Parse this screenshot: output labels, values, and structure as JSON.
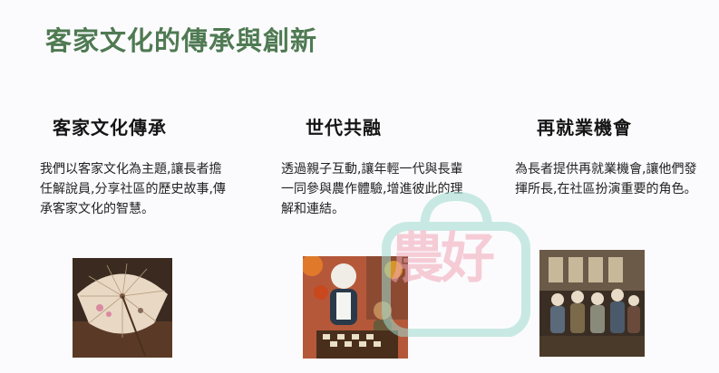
{
  "page": {
    "title": "客家文化的傳承與創新"
  },
  "columns": [
    {
      "title": "客家文化傳承",
      "text": "我們以客家文化為主題,讓長者擔任解說員,分享社區的歷史故事,傳承客家文化的智慧。",
      "image_icon": "oil-paper-umbrella-image"
    },
    {
      "title": "世代共融",
      "text": "透過親子互動,讓年輕一代與長輩一同參與農作體驗,增進彼此的理解和連結。",
      "image_icon": "elder-and-child-chess-image"
    },
    {
      "title": "再就業機會",
      "text": "為長者提供再就業機會,讓他們發揮所長,在社區扮演重要的角色。",
      "image_icon": "elders-group-image"
    }
  ],
  "watermark": {
    "text": "農好",
    "icon": "shopping-bag-logo"
  },
  "colors": {
    "title_green": "#4f7a52",
    "watermark_teal": "#9fdccf",
    "watermark_pink": "#f1a7b8"
  }
}
